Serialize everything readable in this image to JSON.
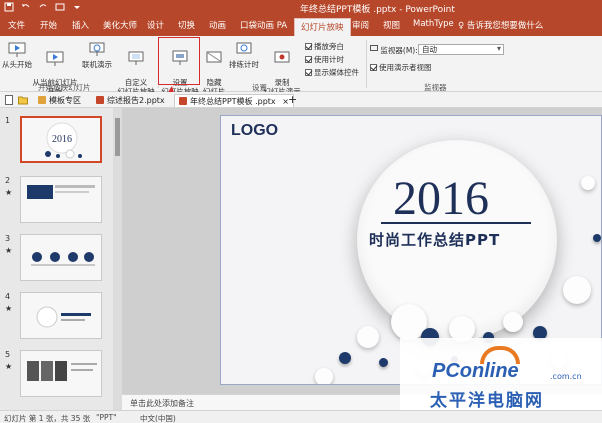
{
  "window": {
    "title": "年终总结PPT模板 .pptx - PowerPoint"
  },
  "ribbon_tabs": [
    "文件",
    "开始",
    "插入",
    "美化大师",
    "设计",
    "切换",
    "动画",
    "口袋动画 PA",
    "幻灯片放映",
    "审阅",
    "视图",
    "MathType"
  ],
  "active_tab": "幻灯片放映",
  "tell_me": "♀ 告诉我您想要做什么",
  "ribbon": {
    "from_start": "从头开始",
    "from_current": "从当前幻灯片\n开始",
    "online": "联机演示",
    "custom": "自定义\n幻灯片放映",
    "group_start": "开始放映幻灯片",
    "setup": "设置\n幻灯片放映",
    "hide": "隐藏\n幻灯片",
    "rehearse": "排练计时",
    "record": "录制\n幻灯片演示",
    "group_setup": "设置",
    "chk_narration": "播放旁白",
    "chk_timing": "使用计时",
    "chk_media": "显示媒体控件",
    "monitor_label": "监视器(M):",
    "monitor_value": "自动",
    "chk_presenter": "使用演示者视图",
    "group_monitor": "监视器"
  },
  "file_tabs": {
    "home": "模板专区",
    "tab1": "综述报告2.pptx",
    "tab2": "年终总结PPT模板 .pptx"
  },
  "thumbnails": [
    "1",
    "2",
    "3",
    "4",
    "5"
  ],
  "slide": {
    "logo": "LOGO",
    "year": "2016",
    "subtitle": "时尚工作总结PPT"
  },
  "notes_placeholder": "单击此处添加备注",
  "status": {
    "slide_info": "幻灯片 第 1 张，共 35 张",
    "theme": "\"PPT\"",
    "language": "中文(中国)"
  },
  "watermark": {
    "name": "PConline",
    "domain": ".com.cn",
    "cn": "太平洋电脑网"
  },
  "colors": {
    "accent": "#b7472a",
    "slide_navy": "#1e2f58",
    "highlight": "#d62b2b"
  }
}
